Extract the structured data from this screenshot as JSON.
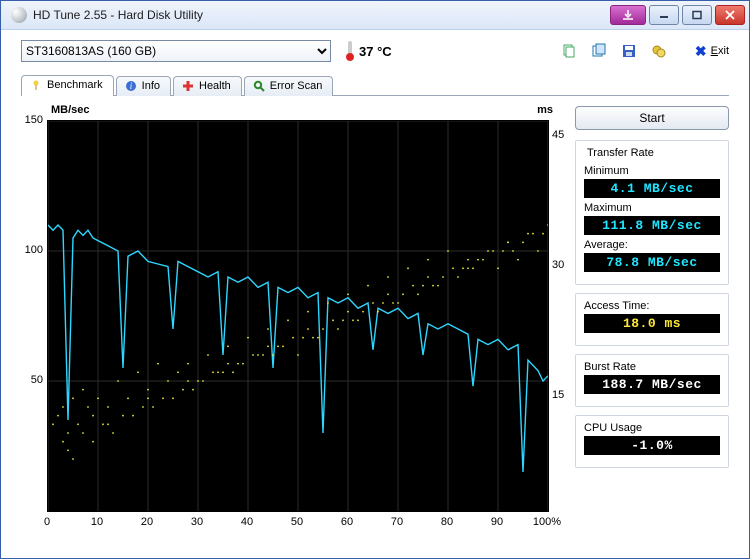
{
  "window": {
    "title": "HD Tune 2.55 - Hard Disk Utility"
  },
  "toolbar": {
    "drive": "ST3160813AS (160 GB)",
    "temp": "37 °C",
    "exit": "Exit"
  },
  "tabs": [
    {
      "id": "benchmark",
      "label": "Benchmark"
    },
    {
      "id": "info",
      "label": "Info"
    },
    {
      "id": "health",
      "label": "Health"
    },
    {
      "id": "errorscan",
      "label": "Error Scan"
    }
  ],
  "buttons": {
    "start": "Start"
  },
  "results": {
    "transfer_title": "Transfer Rate",
    "min_label": "Minimum",
    "min_value": "4.1 MB/sec",
    "max_label": "Maximum",
    "max_value": "111.8 MB/sec",
    "avg_label": "Average:",
    "avg_value": "78.8 MB/sec",
    "access_label": "Access Time:",
    "access_value": "18.0 ms",
    "burst_label": "Burst Rate",
    "burst_value": "188.7 MB/sec",
    "cpu_label": "CPU Usage",
    "cpu_value": "-1.0%"
  },
  "chart_data": {
    "type": "line",
    "title": "",
    "xlabel": "%",
    "ylabel_left": "MB/sec",
    "ylabel_right": "ms",
    "xlim": [
      0,
      100
    ],
    "ylim_left": [
      0,
      150
    ],
    "ylim_right": [
      0,
      45
    ],
    "xticks": [
      0,
      10,
      20,
      30,
      40,
      50,
      60,
      70,
      80,
      90,
      100
    ],
    "yticks_left": [
      50,
      100,
      150
    ],
    "yticks_right": [
      15,
      30,
      45
    ],
    "series": [
      {
        "name": "Transfer Rate (MB/sec)",
        "axis": "left",
        "color": "#2fd6ff",
        "x": [
          0,
          1,
          2,
          3,
          4,
          5,
          6,
          7,
          8,
          9,
          10,
          12,
          14,
          15,
          16,
          18,
          20,
          22,
          24,
          25,
          26,
          28,
          30,
          32,
          34,
          35,
          36,
          38,
          40,
          42,
          44,
          45,
          46,
          48,
          50,
          52,
          54,
          55,
          56,
          58,
          60,
          62,
          64,
          65,
          66,
          68,
          70,
          72,
          74,
          75,
          76,
          78,
          80,
          82,
          84,
          85,
          86,
          88,
          90,
          92,
          94,
          95,
          96,
          97,
          98,
          99,
          100
        ],
        "y": [
          110,
          108,
          110,
          108,
          35,
          105,
          108,
          106,
          108,
          105,
          104,
          102,
          100,
          55,
          98,
          100,
          96,
          95,
          94,
          70,
          96,
          94,
          92,
          90,
          92,
          60,
          90,
          88,
          90,
          86,
          88,
          55,
          86,
          84,
          86,
          82,
          84,
          30,
          82,
          80,
          82,
          78,
          80,
          62,
          78,
          76,
          78,
          74,
          76,
          60,
          72,
          70,
          72,
          70,
          68,
          48,
          66,
          64,
          66,
          62,
          64,
          15,
          58,
          56,
          54,
          50,
          52
        ]
      },
      {
        "name": "Access Time (ms)",
        "axis": "right",
        "color": "#e7e43a",
        "type": "scatter",
        "x": [
          1,
          2,
          3,
          4,
          5,
          6,
          7,
          8,
          9,
          10,
          12,
          14,
          16,
          18,
          20,
          22,
          24,
          26,
          28,
          30,
          32,
          34,
          36,
          38,
          40,
          42,
          44,
          46,
          48,
          50,
          52,
          54,
          56,
          58,
          60,
          62,
          64,
          66,
          68,
          70,
          72,
          74,
          76,
          78,
          80,
          82,
          84,
          86,
          88,
          90,
          92,
          94,
          96,
          98,
          100,
          3,
          7,
          11,
          15,
          19,
          23,
          27,
          31,
          35,
          39,
          43,
          47,
          51,
          55,
          59,
          63,
          67,
          71,
          75,
          79,
          83,
          87,
          91,
          95,
          99,
          5,
          13,
          21,
          29,
          37,
          45,
          53,
          61,
          69,
          77,
          85,
          93,
          4,
          12,
          20,
          28,
          36,
          44,
          52,
          60,
          68,
          76,
          84,
          92,
          9,
          17,
          25,
          33,
          41,
          49,
          57,
          65,
          73,
          81,
          89,
          97
        ],
        "y": [
          10,
          11,
          12,
          9,
          13,
          10,
          14,
          12,
          11,
          13,
          12,
          15,
          13,
          16,
          14,
          17,
          15,
          16,
          17,
          15,
          18,
          16,
          19,
          17,
          20,
          18,
          21,
          19,
          22,
          18,
          23,
          20,
          24,
          21,
          25,
          22,
          26,
          23,
          27,
          24,
          28,
          25,
          29,
          26,
          30,
          27,
          28,
          29,
          30,
          28,
          31,
          29,
          32,
          30,
          33,
          8,
          9,
          10,
          11,
          12,
          13,
          14,
          15,
          16,
          17,
          18,
          19,
          20,
          21,
          22,
          23,
          24,
          25,
          26,
          27,
          28,
          29,
          30,
          31,
          32,
          6,
          9,
          12,
          14,
          16,
          18,
          20,
          22,
          24,
          26,
          28,
          30,
          7,
          10,
          13,
          15,
          17,
          19,
          21,
          23,
          25,
          27,
          29,
          31,
          8,
          11,
          13,
          16,
          18,
          20,
          22,
          24,
          26,
          28,
          30,
          32
        ]
      }
    ]
  }
}
